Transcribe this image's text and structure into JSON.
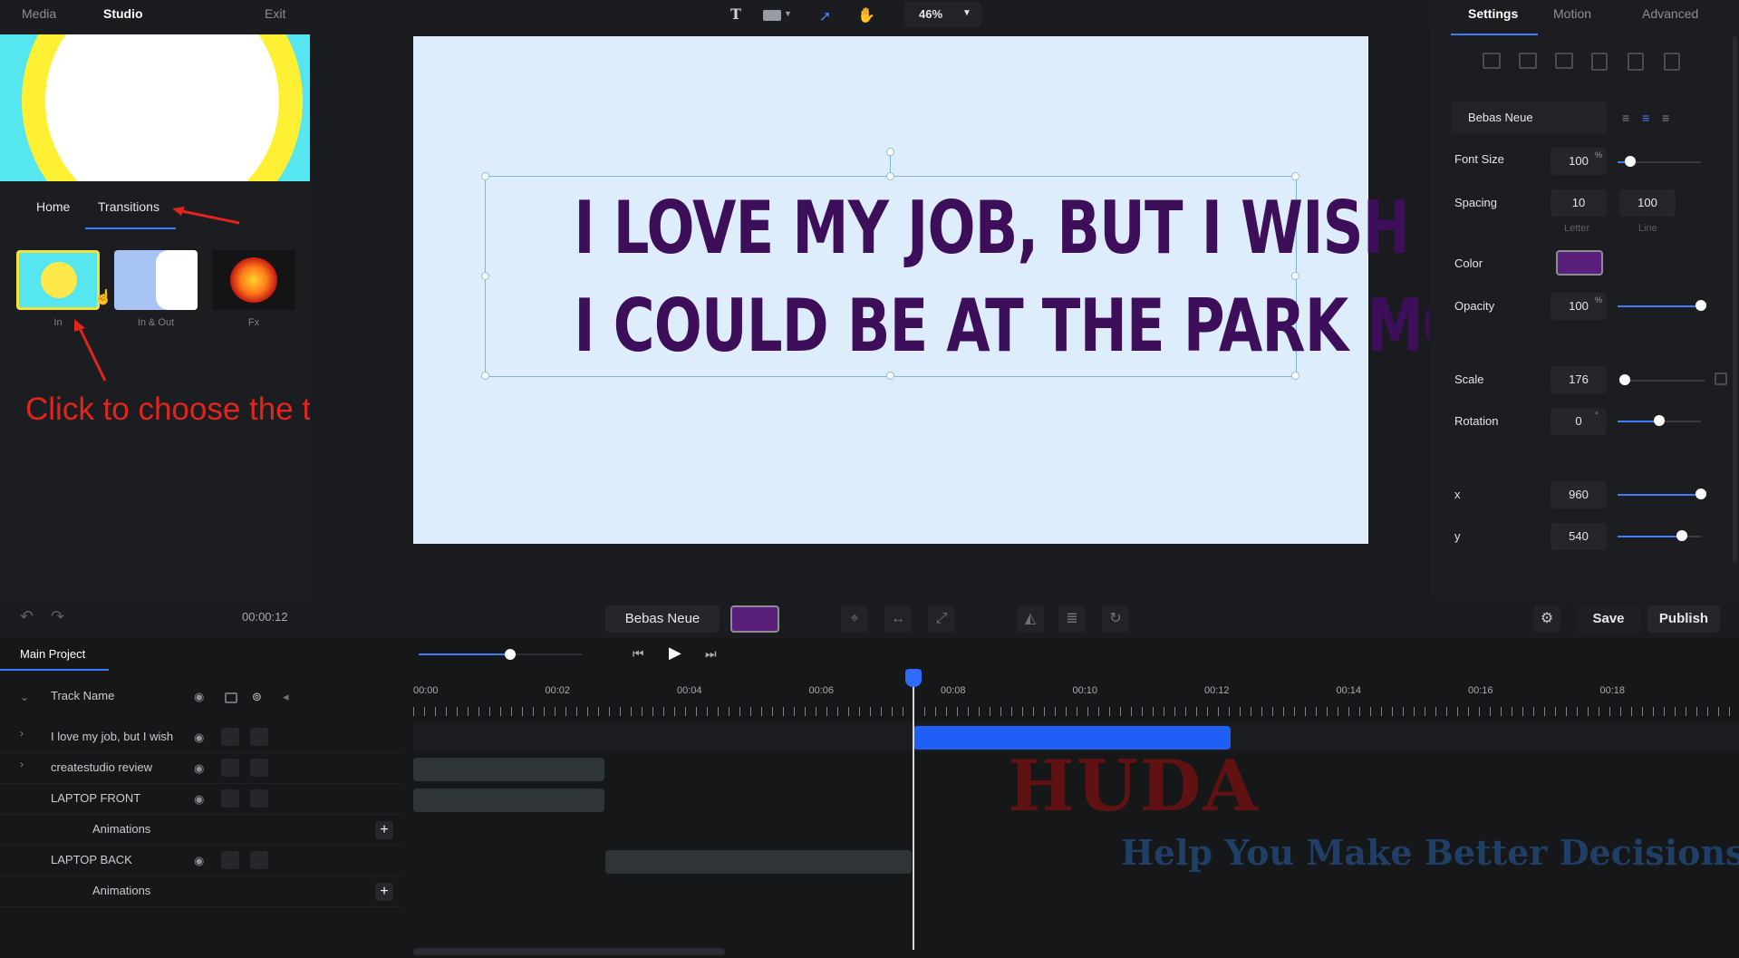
{
  "topbar": {
    "tabs": [
      "Media",
      "Studio",
      "Exit"
    ],
    "zoom": "46%"
  },
  "left_panel": {
    "subtabs": [
      "Home",
      "Transitions"
    ],
    "transitions": [
      {
        "label": "In",
        "selected": true
      },
      {
        "label": "In & Out",
        "selected": false
      },
      {
        "label": "Fx",
        "selected": false
      }
    ],
    "annotation": "Click to choose the transition."
  },
  "canvas": {
    "line1": "I LOVE MY JOB, BUT I WISH",
    "line2": "I COULD BE AT THE PARK MORE",
    "text_color": "#3d0f5a",
    "background": "#deedfb"
  },
  "right_panel": {
    "tabs": [
      "Settings",
      "Motion",
      "Advanced"
    ],
    "font": "Bebas Neue",
    "font_size": {
      "label": "Font Size",
      "value": "100",
      "unit": "%",
      "level": 0.15
    },
    "spacing": {
      "label": "Spacing",
      "letter": "10",
      "line": "100",
      "letter_label": "Letter",
      "line_label": "Line"
    },
    "color": {
      "label": "Color",
      "value": "#5a1f7a"
    },
    "opacity": {
      "label": "Opacity",
      "value": "100",
      "unit": "%",
      "level": 1.0
    },
    "scale": {
      "label": "Scale",
      "value": "176",
      "level": 0.0
    },
    "rotation": {
      "label": "Rotation",
      "value": "0",
      "unit": "°",
      "level": 0.5
    },
    "x": {
      "label": "x",
      "value": "960",
      "level": 1.0
    },
    "y": {
      "label": "y",
      "value": "540",
      "level": 0.77
    }
  },
  "toolbar": {
    "time": "00:00:12",
    "font": "Bebas Neue",
    "color": "#5a1f7a",
    "save": "Save",
    "publish": "Publish"
  },
  "timeline": {
    "project_tab": "Main Project",
    "track_header": "Track Name",
    "tracks": [
      {
        "name": "I love my job, but I wish",
        "expandable": true
      },
      {
        "name": "createstudio review",
        "expandable": true
      },
      {
        "name": "LAPTOP FRONT",
        "expandable": false
      },
      {
        "name": "Animations",
        "sub": true
      },
      {
        "name": "LAPTOP BACK",
        "expandable": false
      },
      {
        "name": "Animations",
        "sub": true
      }
    ],
    "ruler": [
      "00:00",
      "00:02",
      "00:04",
      "00:06",
      "00:08",
      "00:10",
      "00:12",
      "00:14",
      "00:16",
      "00:18"
    ]
  },
  "watermark": {
    "title": "HUDA",
    "tagline": "Help You Make Better Decisions"
  }
}
